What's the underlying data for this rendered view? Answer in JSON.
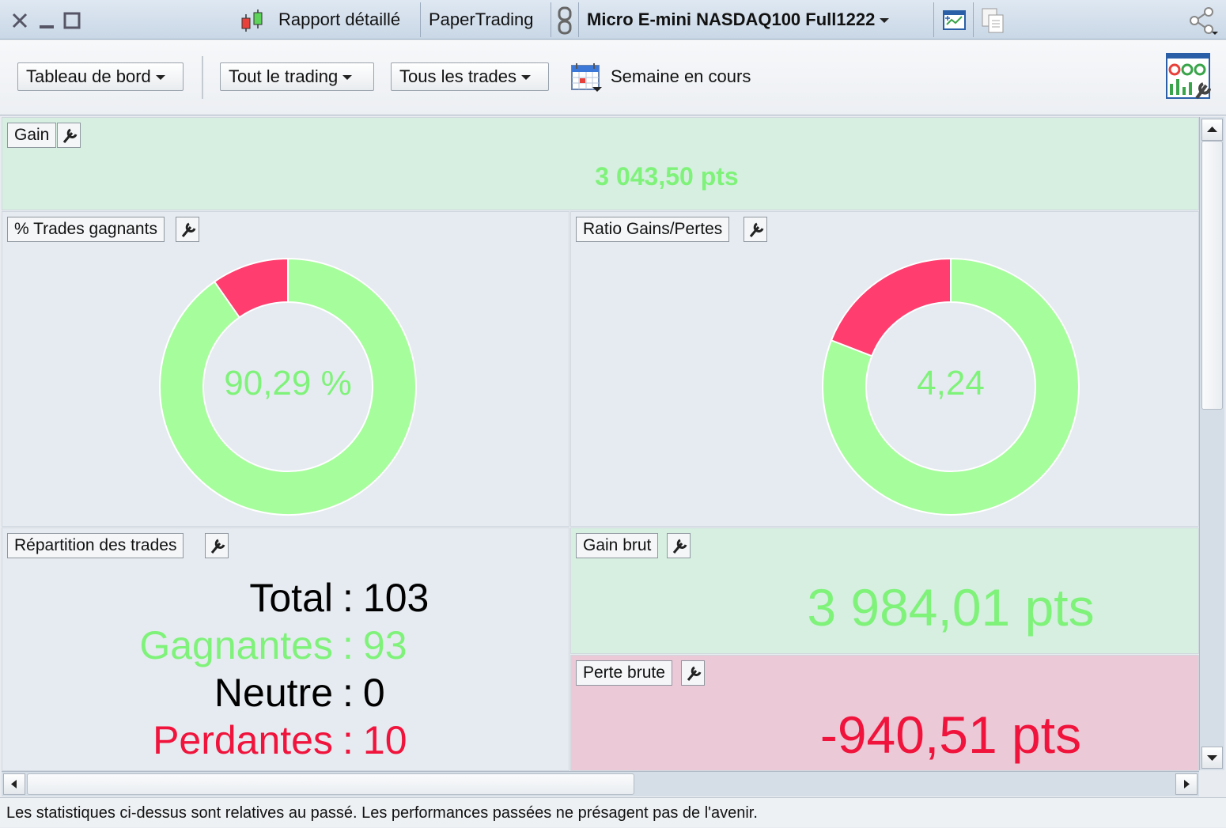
{
  "titlebar": {
    "report_label": "Rapport détaillé",
    "account_label": "PaperTrading",
    "instrument_label": "Micro E-mini NASDAQ100 Full1222"
  },
  "toolbar": {
    "view_select": "Tableau de bord",
    "trading_select": "Tout le trading",
    "trades_select": "Tous les trades",
    "period_label": "Semaine en cours"
  },
  "panels": {
    "gain": {
      "title": "Gain",
      "value": "3 043,50 pts"
    },
    "win_pct": {
      "title": "% Trades gagnants",
      "center": "90,29 %",
      "fraction": 0.9029
    },
    "ratio": {
      "title": "Ratio Gains/Pertes",
      "center": "4,24",
      "fraction": 0.809
    },
    "repartition": {
      "title": "Répartition des trades",
      "rows": [
        {
          "label": "Total",
          "value": "103"
        },
        {
          "label": "Gagnantes",
          "value": "93"
        },
        {
          "label": "Neutre",
          "value": "0"
        },
        {
          "label": "Perdantes",
          "value": "10"
        }
      ]
    },
    "gross_gain": {
      "title": "Gain brut",
      "value": "3 984,01 pts"
    },
    "gross_loss": {
      "title": "Perte brute",
      "value": "-940,51 pts"
    }
  },
  "colors": {
    "win": "#a6fd9c",
    "loss": "#ff3d6e",
    "win_text": "#7ff27a",
    "loss_text": "#f0143c"
  },
  "status_text": "Les statistiques ci-dessus sont relatives au passé. Les performances passées ne présagent pas de l'avenir."
}
